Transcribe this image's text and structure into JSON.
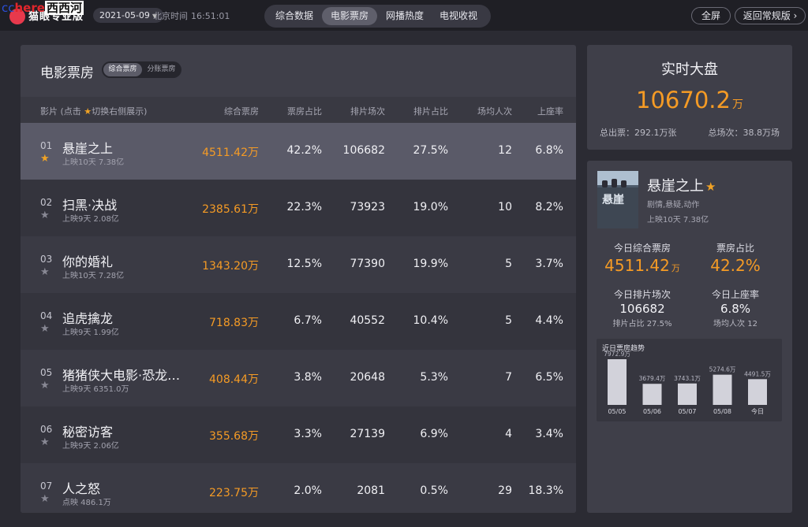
{
  "watermark": {
    "part1": "cc",
    "part2": "here",
    "part3": "西西河"
  },
  "header": {
    "logo_text": "猫眼专业版",
    "date": "2021-05-09",
    "clock_label": "北京时间",
    "clock_time": "16:51:01",
    "tabs": [
      {
        "label": "综合数据",
        "active": false
      },
      {
        "label": "电影票房",
        "active": true
      },
      {
        "label": "网播热度",
        "active": false
      },
      {
        "label": "电视收视",
        "active": false
      }
    ],
    "fullscreen_label": "全屏",
    "back_label": "返回常规版 ›"
  },
  "boxoffice": {
    "title": "电影票房",
    "segments": [
      {
        "label": "综合票房",
        "active": true
      },
      {
        "label": "分账票房",
        "active": false
      }
    ],
    "columns": {
      "film_pre": "影片 (点击",
      "film_star": "★",
      "film_post": "切换右侧展示)",
      "gross": "综合票房",
      "gross_share": "票房占比",
      "screenings": "排片场次",
      "screening_share": "排片占比",
      "avg_per_show": "场均人次",
      "occupancy": "上座率"
    },
    "rows": [
      {
        "rank": "01",
        "name": "悬崖之上",
        "sub": "上映10天  7.38亿",
        "gross": "4511.42万",
        "gross_share": "42.2%",
        "screenings": "106682",
        "screening_share": "27.5%",
        "avg": "12",
        "occupancy": "6.8%",
        "selected": true
      },
      {
        "rank": "02",
        "name": "扫黑·决战",
        "sub": "上映9天  2.08亿",
        "gross": "2385.61万",
        "gross_share": "22.3%",
        "screenings": "73923",
        "screening_share": "19.0%",
        "avg": "10",
        "occupancy": "8.2%"
      },
      {
        "rank": "03",
        "name": "你的婚礼",
        "sub": "上映10天  7.28亿",
        "gross": "1343.20万",
        "gross_share": "12.5%",
        "screenings": "77390",
        "screening_share": "19.9%",
        "avg": "5",
        "occupancy": "3.7%"
      },
      {
        "rank": "04",
        "name": "追虎擒龙",
        "sub": "上映9天  1.99亿",
        "gross": "718.83万",
        "gross_share": "6.7%",
        "screenings": "40552",
        "screening_share": "10.4%",
        "avg": "5",
        "occupancy": "4.4%"
      },
      {
        "rank": "05",
        "name": "猪猪侠大电影·恐龙…",
        "sub": "上映9天  6351.0万",
        "gross": "408.44万",
        "gross_share": "3.8%",
        "screenings": "20648",
        "screening_share": "5.3%",
        "avg": "7",
        "occupancy": "6.5%"
      },
      {
        "rank": "06",
        "name": "秘密访客",
        "sub": "上映9天  2.06亿",
        "gross": "355.68万",
        "gross_share": "3.3%",
        "screenings": "27139",
        "screening_share": "6.9%",
        "avg": "4",
        "occupancy": "3.4%"
      },
      {
        "rank": "07",
        "name": "人之怒",
        "sub": "点映  486.1万",
        "gross": "223.75万",
        "gross_share": "2.0%",
        "screenings": "2081",
        "screening_share": "0.5%",
        "avg": "29",
        "occupancy": "18.3%"
      }
    ]
  },
  "realtime": {
    "title": "实时大盘",
    "total": "10670.2",
    "total_unit": "万",
    "tickets": "总出票：292.1万张",
    "shows": "总场次：38.8万场"
  },
  "detail": {
    "name": "悬崖之上",
    "poster_text": "悬崖",
    "genre": "剧情,悬疑,动作",
    "release": "上映10天  7.38亿",
    "today_gross_label": "今日综合票房",
    "today_gross": "4511.42",
    "today_gross_unit": "万",
    "share_label": "票房占比",
    "share": "42.2%",
    "screenings_label": "今日排片场次",
    "screenings": "106682",
    "screening_share_note": "排片占比 27.5%",
    "occupancy_label": "今日上座率",
    "occupancy": "6.8%",
    "avg_note": "场均人次 12"
  },
  "chart_data": {
    "type": "bar",
    "title": "近日票房趋势",
    "categories": [
      "05/05",
      "05/06",
      "05/07",
      "05/08",
      "今日"
    ],
    "values": [
      7972.9,
      3679.4,
      3743.1,
      5274.6,
      4491.5
    ],
    "value_labels": [
      "7972.9万",
      "3679.4万",
      "3743.1万",
      "5274.6万",
      "4491.5万"
    ],
    "color": "#5e5e6a"
  }
}
